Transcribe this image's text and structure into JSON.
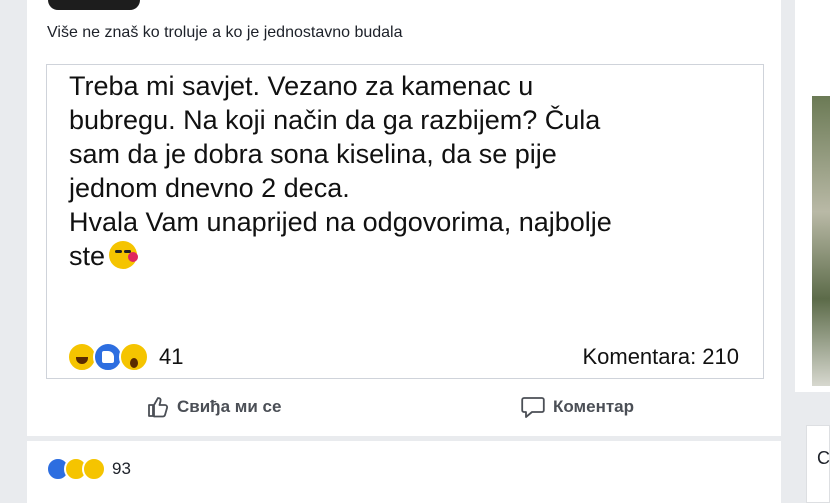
{
  "caption": "Više ne znaš ko troluje a ko je jednostavno budala",
  "shared_post": {
    "lines": [
      "Treba mi savjet. Vezano za kamenac u",
      "bubregu. Na koji način da ga razbijem? Čula",
      "sam da je dobra sona kiselina, da se pije",
      "jednom dnevno 2 deca.",
      "Hvala Vam unaprijed na odgovorima, najbolje",
      "ste"
    ],
    "trailing_emoji": "kiss-heart-emoji",
    "reaction_count": "41",
    "comments": "Komentara: 210"
  },
  "actions": {
    "like_label": "Свиђа ми се",
    "comment_label": "Коментар"
  },
  "footer": {
    "reaction_count": "93"
  },
  "right_panel": {
    "letter": "C"
  },
  "colors": {
    "like_blue": "#2d6ee0",
    "emoji_yellow": "#f5c400",
    "background": "#e9ebee"
  }
}
